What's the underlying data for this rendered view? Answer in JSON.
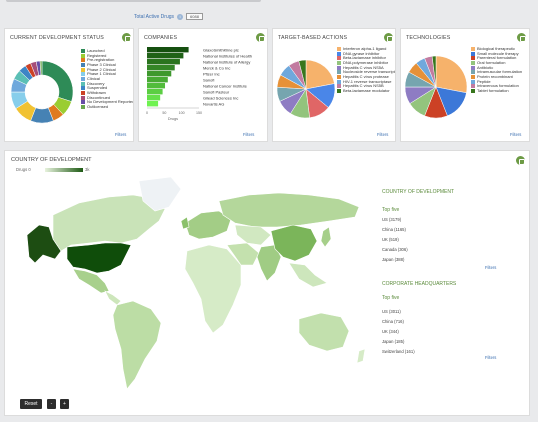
{
  "header": {
    "total_label": "Total Active Drugs",
    "total_count": "6088"
  },
  "panels": {
    "status": {
      "title": "CURRENT DEVELOPMENT STATUS",
      "filters": "Filters",
      "legend": [
        {
          "label": "Launched",
          "color": "#2e8b57"
        },
        {
          "label": "Registered",
          "color": "#9acd32"
        },
        {
          "label": "Pre-registration",
          "color": "#e07a1f"
        },
        {
          "label": "Phase 3 Clinical",
          "color": "#4682b4"
        },
        {
          "label": "Phase 2 Clinical",
          "color": "#f1c232"
        },
        {
          "label": "Phase 1 Clinical",
          "color": "#87ceeb"
        },
        {
          "label": "Clinical",
          "color": "#6fa8dc"
        },
        {
          "label": "Discovery",
          "color": "#5bbfb5"
        },
        {
          "label": "Suspended",
          "color": "#3d85c6"
        },
        {
          "label": "Withdrawn",
          "color": "#cc4125"
        },
        {
          "label": "Discontinued",
          "color": "#a64d79"
        },
        {
          "label": "No Development Reported",
          "color": "#674ea7"
        },
        {
          "label": "Outlicensed",
          "color": "#6aa84f"
        }
      ]
    },
    "companies": {
      "title": "COMPANIES",
      "filters": "Filters",
      "axis_label": "Drugs",
      "ticks": [
        "0",
        "50",
        "100",
        "150"
      ],
      "bars": [
        {
          "name": "GlaxoSmithKline plc",
          "value": 120
        },
        {
          "name": "National Institutes of Health",
          "value": 105
        },
        {
          "name": "National Institute of Allergy",
          "value": 95
        },
        {
          "name": "Merck & Co Inc",
          "value": 80
        },
        {
          "name": "Pfizer Inc",
          "value": 70
        },
        {
          "name": "Sanofi",
          "value": 60
        },
        {
          "name": "National Cancer Institute",
          "value": 52
        },
        {
          "name": "Sanofi Pasteur",
          "value": 45
        },
        {
          "name": "Gilead Sciences Inc",
          "value": 38
        },
        {
          "name": "Novartis AG",
          "value": 32
        }
      ]
    },
    "actions": {
      "title": "TARGET-BASED ACTIONS",
      "filters": "Filters",
      "legend": [
        {
          "label": "Interferon alpha-1 ligand",
          "color": "#f6b26b"
        },
        {
          "label": "DNA gyrase inhibitor",
          "color": "#4a86e8"
        },
        {
          "label": "Beta-lactamase inhibitor",
          "color": "#e06666"
        },
        {
          "label": "DNA polymerase inhibitor",
          "color": "#93c47d"
        },
        {
          "label": "Hepatitis C virus NS5A",
          "color": "#8e7cc3"
        },
        {
          "label": "Nucleoside reverse transcriptase",
          "color": "#76a5af"
        },
        {
          "label": "Hepatitis C virus protease",
          "color": "#e69138"
        },
        {
          "label": "HIV-1 reverse transcriptase",
          "color": "#6fa8dc"
        },
        {
          "label": "Hepatitis C virus NS5B",
          "color": "#c27ba0"
        },
        {
          "label": "Beta-lactamase modulator",
          "color": "#38761d"
        }
      ]
    },
    "technologies": {
      "title": "TECHNOLOGIES",
      "filters": "Filters",
      "legend": [
        {
          "label": "Biological therapeutic",
          "color": "#f6b26b"
        },
        {
          "label": "Small molecule therapy",
          "color": "#3c78d8"
        },
        {
          "label": "Parenteral formulation",
          "color": "#cc4125"
        },
        {
          "label": "Oral formulation",
          "color": "#93c47d"
        },
        {
          "label": "Antibiotic",
          "color": "#8e7cc3"
        },
        {
          "label": "Intramuscular formulation",
          "color": "#76a5af"
        },
        {
          "label": "Protein recombinant",
          "color": "#e69138"
        },
        {
          "label": "Peptide",
          "color": "#6fa8dc"
        },
        {
          "label": "Intravenous formulation",
          "color": "#c27ba0"
        },
        {
          "label": "Tablet formulation",
          "color": "#38761d"
        }
      ]
    }
  },
  "map": {
    "title": "COUNTRY OF DEVELOPMENT",
    "scale_label": "Drugs",
    "scale_min": "0",
    "scale_max": "3k",
    "buttons": {
      "reset": "Reset",
      "zoom_out": "-",
      "zoom_in": "+"
    }
  },
  "side": {
    "development": {
      "title": "COUNTRY OF DEVELOPMENT",
      "subtitle": "Top five",
      "rows": [
        "US (3179)",
        "China (1165)",
        "UK (519)",
        "Canada (306)",
        "Japan (388)"
      ],
      "filters": "Filters"
    },
    "headquarters": {
      "title": "CORPORATE HEADQUARTERS",
      "subtitle": "Top five",
      "rows": [
        "US (3011)",
        "China (716)",
        "UK (344)",
        "Japan (185)",
        "Switzerland (161)"
      ],
      "filters": "Filters"
    }
  }
}
